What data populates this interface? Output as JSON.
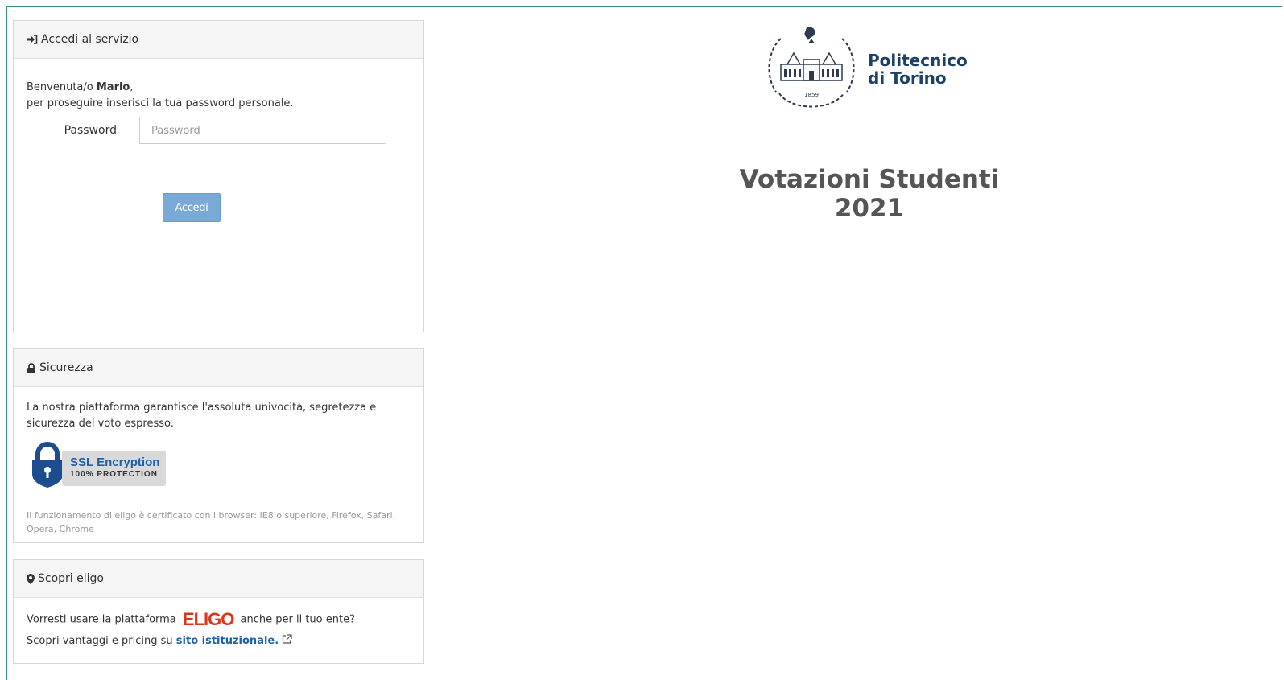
{
  "login_panel": {
    "header": "Accedi al servizio",
    "welcome_prefix": "Benvenuta/o ",
    "user_name": "Mario",
    "welcome_suffix": ",",
    "instruction": "per proseguire inserisci la tua password personale.",
    "password_label": "Password",
    "password_placeholder": "Password",
    "password_value": "",
    "submit_label": "Accedi"
  },
  "security_panel": {
    "header": "Sicurezza",
    "text": "La nostra piattaforma garantisce l'assoluta univocità, segretezza e sicurezza del voto espresso.",
    "ssl_title": "SSL Encryption",
    "ssl_subtitle": "100% PROTECTION",
    "browser_note": "Il funzionamento di eligo è certificato con i browser: IE8 o superiore, Firefox, Safari, Opera, Chrome"
  },
  "discover_panel": {
    "header": "Scopri eligo",
    "line1_prefix": "Vorresti usare la piattaforma",
    "eligo_logo": "ELIGO",
    "line1_suffix": "anche per il tuo ente?",
    "line2_prefix": "Scopri vantaggi e pricing su",
    "link_label": "sito istituzionale."
  },
  "institution": {
    "name_line1": "Politecnico",
    "name_line2": "di Torino",
    "seal_year": "1859"
  },
  "page_title": "Votazioni Studenti 2021",
  "colors": {
    "accent": "#3a8c84",
    "button": "#7aa9d6",
    "link": "#1f5fa6",
    "eligo_brand": "#d9361c",
    "institution_text": "#1e3f66"
  },
  "icons": {
    "login": "sign-in-icon",
    "security": "lock-icon",
    "discover": "map-marker-icon",
    "external": "external-link-icon"
  }
}
